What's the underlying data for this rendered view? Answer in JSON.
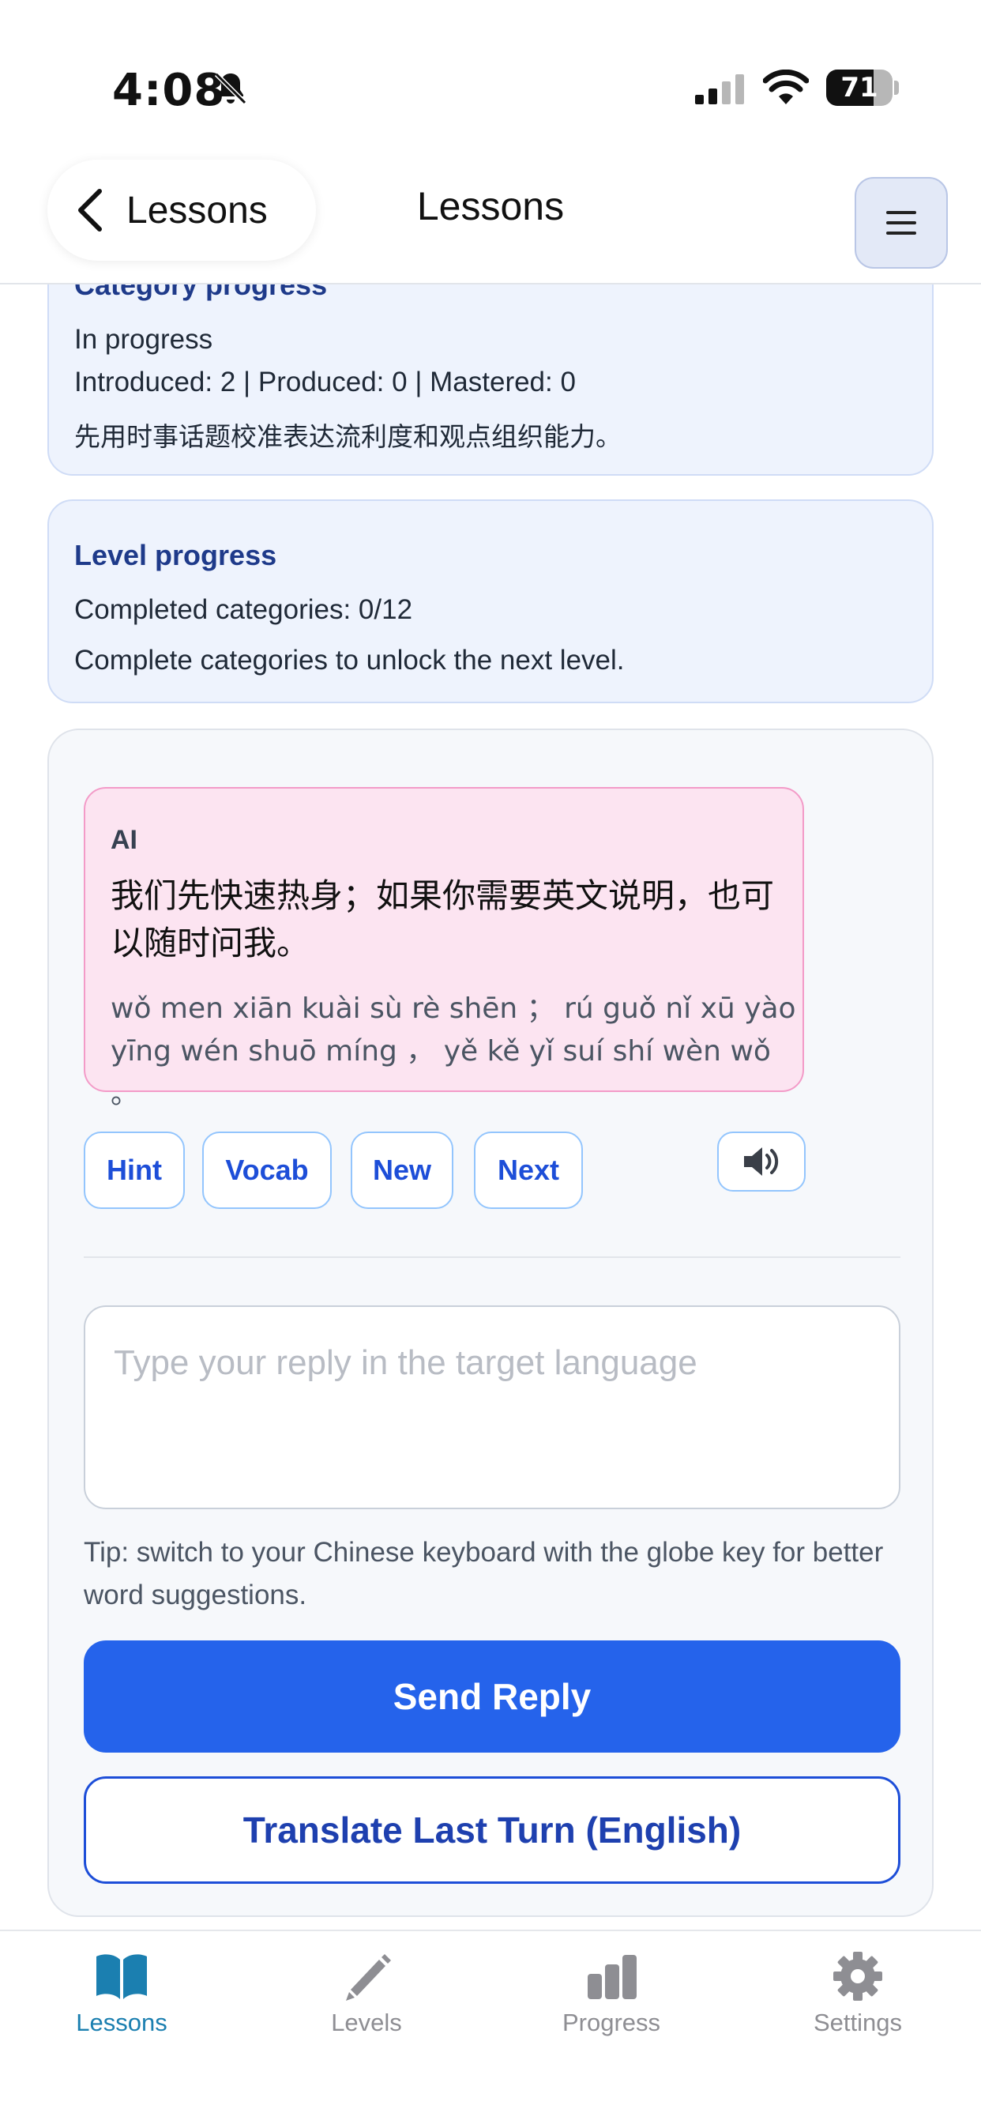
{
  "status_bar": {
    "time": "4:08",
    "battery": "71",
    "battery_level_percent": 71
  },
  "header": {
    "back_label": "Lessons",
    "title": "Lessons"
  },
  "category_card": {
    "title": "Category progress",
    "status": "In progress",
    "stats": "Introduced: 2 | Produced: 0 | Mastered: 0",
    "description": "先用时事话题校准表达流利度和观点组织能力。"
  },
  "level_card": {
    "title": "Level progress",
    "completed": "Completed categories: 0/12",
    "note": "Complete categories to unlock the next level."
  },
  "chat": {
    "speaker": "AI",
    "message": "我们先快速热身；如果你需要英文说明，也可以随时问我。",
    "pinyin": "wǒ men xiān kuài sù rè shēn ； rú guǒ nǐ xū yào yīng wén shuō míng ， yě kě yǐ suí shí wèn wǒ 。",
    "actions": [
      "Hint",
      "Vocab",
      "New",
      "Next"
    ],
    "input_placeholder": "Type your reply in the target language",
    "input_value": "",
    "tip": "Tip: switch to your Chinese keyboard with the globe key for better word suggestions.",
    "send_label": "Send Reply",
    "translate_label": "Translate Last Turn (English)"
  },
  "tabs": [
    {
      "label": "Lessons",
      "icon": "book-icon",
      "active": true
    },
    {
      "label": "Levels",
      "icon": "pencil-icon",
      "active": false
    },
    {
      "label": "Progress",
      "icon": "bar-chart-icon",
      "active": false
    },
    {
      "label": "Settings",
      "icon": "gear-icon",
      "active": false
    }
  ],
  "colors": {
    "accent": "#2563eb",
    "active_tab": "#1b7fb0",
    "ai_bubble": "#fce4f1",
    "card_background": "#eef3fd"
  }
}
